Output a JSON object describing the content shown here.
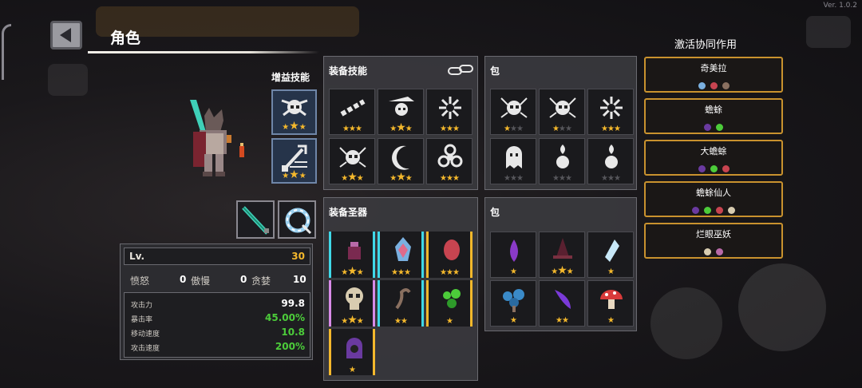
{
  "version": "Ver. 1.0.2",
  "header": {
    "title": "角色"
  },
  "buff": {
    "label": "增益技能"
  },
  "equip_skills": {
    "title": "装备技能"
  },
  "bag_skills": {
    "title": "包"
  },
  "equip_relics": {
    "title": "装备圣器"
  },
  "bag_relics": {
    "title": "包"
  },
  "stats": {
    "lv_label": "Lv.",
    "lv_value": "30",
    "rage_label": "愤怒",
    "rage_value": "0",
    "pride_label": "傲慢",
    "pride_value": "0",
    "greed_label": "贪婪",
    "greed_value": "10",
    "rows": [
      {
        "label": "攻击力",
        "value": "99.8",
        "color": "#ffffff"
      },
      {
        "label": "暴击率",
        "value": "45.00%",
        "color": "#4ccc3a"
      },
      {
        "label": "移动速度",
        "value": "10.8",
        "color": "#4ccc3a"
      },
      {
        "label": "攻击速度",
        "value": "200%",
        "color": "#4ccc3a"
      }
    ]
  },
  "synergy": {
    "title": "激活协同作用",
    "cards": [
      {
        "name": "奇美拉",
        "icons": [
          "crystal-icon",
          "egg-icon",
          "lizard-icon"
        ]
      },
      {
        "name": "蟾蜍",
        "icons": [
          "hood-icon",
          "spore-icon"
        ]
      },
      {
        "name": "大蟾蜍",
        "icons": [
          "hood-icon",
          "spore-icon",
          "egg-icon"
        ]
      },
      {
        "name": "蟾蜍仙人",
        "icons": [
          "hood-icon",
          "spore-icon",
          "egg-icon",
          "skull-icon"
        ]
      },
      {
        "name": "烂眼巫妖",
        "icons": [
          "skull-icon",
          "potion-icon"
        ]
      }
    ]
  },
  "colors": {
    "star": "#f4b82c",
    "synergy_border": "#c9922e",
    "buff_border": "#6f86a8"
  }
}
